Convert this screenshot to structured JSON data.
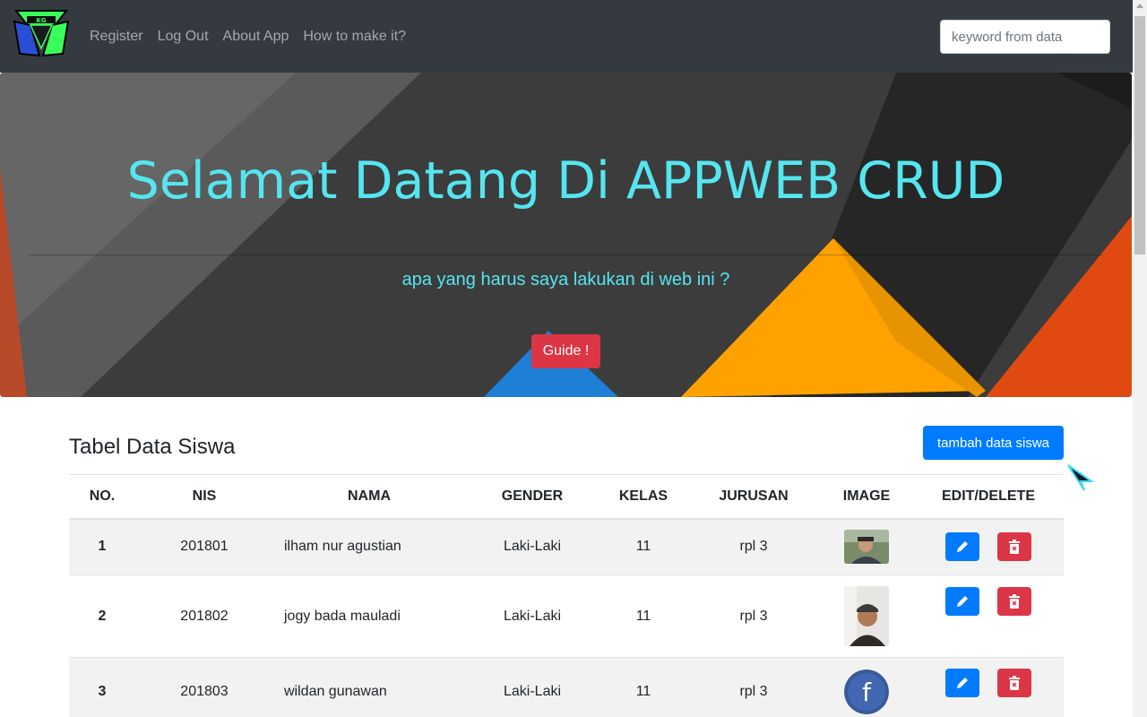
{
  "navbar": {
    "links": [
      "Register",
      "Log Out",
      "About App",
      "How to make it?"
    ],
    "search_placeholder": "keyword from data"
  },
  "jumbotron": {
    "title": "Selamat Datang Di APPWEB CRUD",
    "lead": "apa yang harus saya lakukan di web ini ?",
    "button_label": "Guide !"
  },
  "table_section": {
    "title": "Tabel Data Siswa",
    "add_button_label": "tambah data siswa",
    "headers": [
      "NO.",
      "NIS",
      "NAMA",
      "GENDER",
      "KELAS",
      "JURUSAN",
      "IMAGE",
      "EDIT/DELETE"
    ],
    "rows": [
      {
        "no": "1",
        "nis": "201801",
        "nama": "ilham nur agustian",
        "gender": "Laki-Laki",
        "kelas": "11",
        "jurusan": "rpl 3",
        "image": "photo-person-1"
      },
      {
        "no": "2",
        "nis": "201802",
        "nama": "jogy bada mauladi",
        "gender": "Laki-Laki",
        "kelas": "11",
        "jurusan": "rpl 3",
        "image": "photo-person-2"
      },
      {
        "no": "3",
        "nis": "201803",
        "nama": "wildan gunawan",
        "gender": "Laki-Laki",
        "kelas": "11",
        "jurusan": "rpl 3",
        "image": "facebook-logo"
      }
    ]
  },
  "colors": {
    "navbar": "#343a40",
    "accent_text": "#55e6f0",
    "primary": "#007bff",
    "danger": "#dc3545"
  },
  "icons": [
    "brand-logo-icon",
    "pencil-icon",
    "trash-icon",
    "cursor-arrow-icon"
  ]
}
